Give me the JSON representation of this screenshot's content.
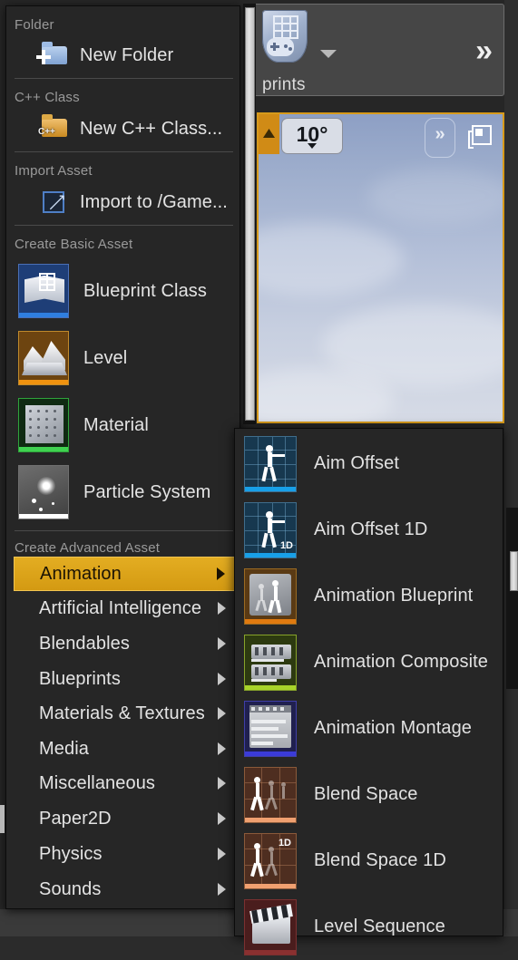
{
  "toolbar": {
    "label": "prints",
    "icon": "blueprint-shield-icon",
    "dropdown_icon": "chevron-down-icon",
    "overflow_icon": "»"
  },
  "viewport": {
    "angle_value": "10°",
    "chevron_icon": "»",
    "maximize_icon": "maximize-viewport-icon",
    "border_color": "#d79a1b"
  },
  "context_menu": {
    "sections": [
      {
        "header": "Folder",
        "items": [
          {
            "label": "New Folder",
            "icon": "new-folder-icon"
          }
        ]
      },
      {
        "header": "C++ Class",
        "items": [
          {
            "label": "New C++ Class...",
            "icon": "cpp-class-icon"
          }
        ]
      },
      {
        "header": "Import Asset",
        "items": [
          {
            "label": "Import to /Game...",
            "icon": "import-asset-icon"
          }
        ]
      },
      {
        "header": "Create Basic Asset",
        "items": [
          {
            "label": "Blueprint Class",
            "icon": "blueprint-class-icon",
            "accent": "#2f7fe0"
          },
          {
            "label": "Level",
            "icon": "level-icon",
            "accent": "#f0920f"
          },
          {
            "label": "Material",
            "icon": "material-icon",
            "accent": "#3fd250"
          },
          {
            "label": "Particle System",
            "icon": "particle-system-icon",
            "accent": "#ffffff"
          }
        ]
      },
      {
        "header": "Create Advanced Asset",
        "items": [
          {
            "label": "Animation",
            "selected": true,
            "has_submenu": true
          },
          {
            "label": "Artificial Intelligence",
            "selected": false,
            "has_submenu": true
          },
          {
            "label": "Blendables",
            "selected": false,
            "has_submenu": true
          },
          {
            "label": "Blueprints",
            "selected": false,
            "has_submenu": true
          },
          {
            "label": "Materials & Textures",
            "selected": false,
            "has_submenu": true
          },
          {
            "label": "Media",
            "selected": false,
            "has_submenu": true
          },
          {
            "label": "Miscellaneous",
            "selected": false,
            "has_submenu": true
          },
          {
            "label": "Paper2D",
            "selected": false,
            "has_submenu": true
          },
          {
            "label": "Physics",
            "selected": false,
            "has_submenu": true
          },
          {
            "label": "Sounds",
            "selected": false,
            "has_submenu": true
          }
        ]
      }
    ],
    "highlight_color": "#d8a21a"
  },
  "submenu": {
    "items": [
      {
        "label": "Aim Offset",
        "icon": "aim-offset-icon",
        "accent": "#18a0e8"
      },
      {
        "label": "Aim Offset 1D",
        "icon": "aim-offset-1d-icon",
        "accent": "#18a0e8",
        "badge": "1D"
      },
      {
        "label": "Animation Blueprint",
        "icon": "animation-blueprint-icon",
        "accent": "#e07a10"
      },
      {
        "label": "Animation Composite",
        "icon": "animation-composite-icon",
        "accent": "#a8d42a"
      },
      {
        "label": "Animation Montage",
        "icon": "animation-montage-icon",
        "accent": "#3b3bd8"
      },
      {
        "label": "Blend Space",
        "icon": "blend-space-icon",
        "accent": "#f0a070"
      },
      {
        "label": "Blend Space 1D",
        "icon": "blend-space-1d-icon",
        "accent": "#f0a070",
        "badge": "1D"
      },
      {
        "label": "Level Sequence",
        "icon": "level-sequence-icon",
        "accent": "#8a3030"
      }
    ]
  }
}
